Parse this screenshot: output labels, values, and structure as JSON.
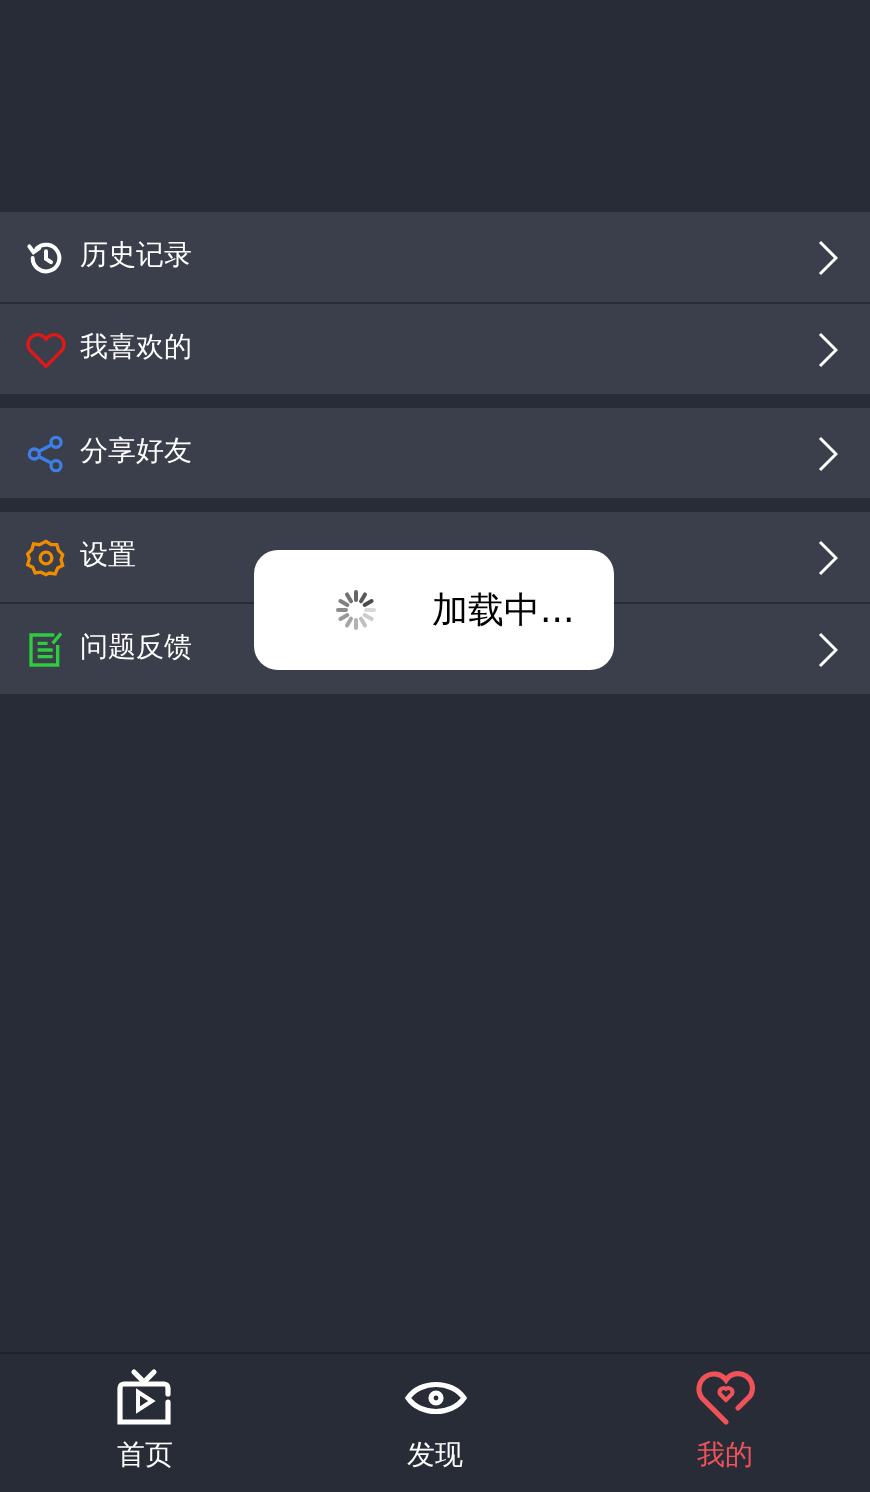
{
  "menu_groups": [
    {
      "items": [
        {
          "label": "历史记录"
        },
        {
          "label": "我喜欢的"
        }
      ]
    },
    {
      "items": [
        {
          "label": "分享好友"
        }
      ]
    },
    {
      "items": [
        {
          "label": "设置"
        },
        {
          "label": "问题反馈"
        }
      ]
    }
  ],
  "loading_toast": {
    "text": "加载中..."
  },
  "tab_bar": [
    {
      "label": "首页",
      "selected": false
    },
    {
      "label": "发现",
      "selected": false
    },
    {
      "label": "我的",
      "selected": true
    }
  ]
}
